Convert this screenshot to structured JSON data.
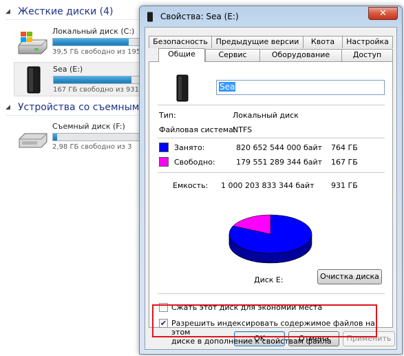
{
  "explorer": {
    "hard_drives_header": "Жесткие диски (4)",
    "removable_header": "Устройства со съемными",
    "drives": [
      {
        "name": "Локальный диск (C:)",
        "free_text": "39,5 ГБ свободно из 195",
        "used_fraction": 0.8
      },
      {
        "name": "Sea (E:)",
        "free_text": "167 ГБ свободно из 931",
        "used_fraction": 0.82
      },
      {
        "name": "Съемный диск (F:)",
        "free_text": "2,98 ГБ свободно из 3",
        "used_fraction": 0.04
      }
    ]
  },
  "dialog": {
    "title": "Свойства: Sea (E:)",
    "close_glyph": "✕",
    "tabs_back": [
      "Безопасность",
      "Предыдущие версии",
      "Квота",
      "Настройка"
    ],
    "tabs_front": [
      "Общие",
      "Сервис",
      "Оборудование",
      "Доступ"
    ],
    "active_tab": "Общие",
    "volume_name": "Sea",
    "type_label": "Тип:",
    "type_value": "Локальный диск",
    "fs_label": "Файловая система:",
    "fs_value": "NTFS",
    "used_label": "Занято:",
    "used_bytes": "820 652 544 000 байт",
    "used_gb": "764 ГБ",
    "free_label": "Свободно:",
    "free_bytes": "179 551 289 344 байт",
    "free_gb": "167 ГБ",
    "capacity_label": "Емкость:",
    "capacity_bytes": "1 000 203 833 344 байт",
    "capacity_gb": "931 ГБ",
    "used_fraction": 0.82,
    "used_color": "#0000ff",
    "free_color": "#ff00ff",
    "disk_label": "Диск E:",
    "cleanup_button": "Очистка диска",
    "compress_label": "Сжать этот диск для экономии места",
    "compress_checked": false,
    "index_label_line1": "Разрешить индексировать содержимое файлов на этом",
    "index_label_line2": "диске в дополнение к свойствам файла",
    "index_checked": true,
    "highlight_color": "#e0141b",
    "ok_button": "OK",
    "cancel_button": "Отмена",
    "apply_button": "Применить"
  }
}
